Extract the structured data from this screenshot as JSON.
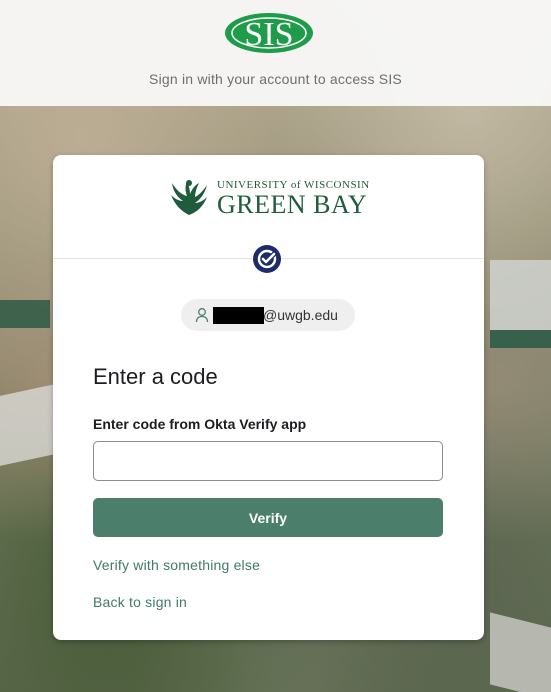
{
  "header": {
    "logo_text": "SIS",
    "subtitle": "Sign in with your account to access SIS"
  },
  "card": {
    "org_logo": {
      "line1": "UNIVERSITY of WISCONSIN",
      "line2": "GREEN BAY"
    },
    "badge_icon": "okta-verify-check-icon",
    "user": {
      "icon": "user-icon",
      "email_suffix": "@uwgb.edu"
    },
    "heading": "Enter a code",
    "code_field": {
      "label": "Enter code from Okta Verify app",
      "value": "",
      "placeholder": ""
    },
    "verify_button": "Verify",
    "links": {
      "verify_else": "Verify with something else",
      "back": "Back to sign in"
    }
  },
  "colors": {
    "primary": "#4b7f6b",
    "link": "#3f7a64",
    "brand_green": "#1f5c3b",
    "okta_blue": "#1d2a6b"
  }
}
